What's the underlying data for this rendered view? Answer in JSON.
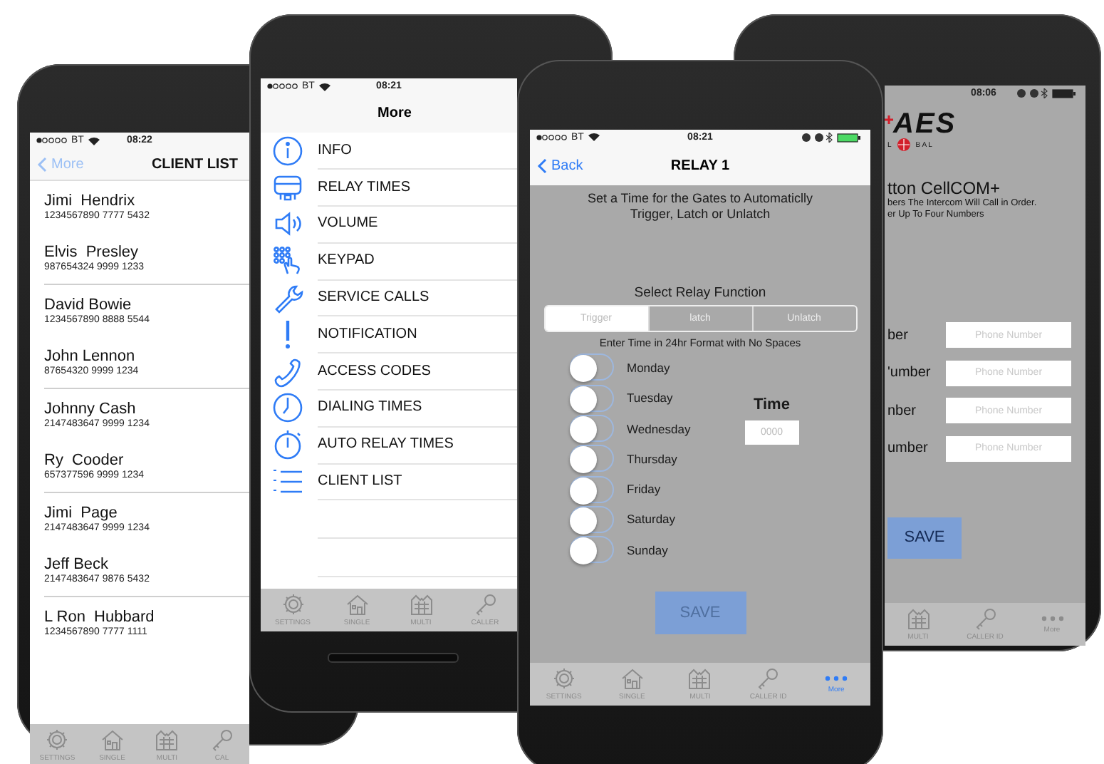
{
  "phones": [
    {
      "kind": "client_list",
      "status": {
        "carrier": "BT",
        "time": "08:22"
      },
      "nav": {
        "back": "More",
        "title": "CLIENT LIST"
      },
      "clients": [
        {
          "name": "Jimi  Hendrix",
          "number": "1234567890 7777 5432"
        },
        {
          "name": "Elvis  Presley",
          "number": "987654324 9999 1233"
        },
        {
          "name": "David Bowie",
          "number": "1234567890 8888 5544"
        },
        {
          "name": "John Lennon",
          "number": "87654320 9999 1234"
        },
        {
          "name": "Johnny Cash",
          "number": "2147483647 9999 1234"
        },
        {
          "name": "Ry  Cooder",
          "number": "657377596 9999 1234"
        },
        {
          "name": "Jimi  Page",
          "number": "2147483647 9999 1234"
        },
        {
          "name": "Jeff Beck",
          "number": "2147483647 9876 5432"
        },
        {
          "name": "L Ron  Hubbard",
          "number": "1234567890 7777 1111"
        }
      ],
      "tabs": [
        {
          "kind": "settings",
          "label": "SETTINGS",
          "selected": false
        },
        {
          "kind": "single",
          "label": "SINGLE",
          "selected": false
        },
        {
          "kind": "multi",
          "label": "MULTI",
          "selected": false
        },
        {
          "kind": "caller",
          "label": "CAL",
          "selected": false
        }
      ]
    },
    {
      "kind": "more_menu",
      "status": {
        "carrier": "BT",
        "time": "08:21"
      },
      "nav": {
        "title": "More"
      },
      "items": [
        {
          "kind": "info",
          "label": "INFO"
        },
        {
          "kind": "relay",
          "label": "RELAY TIMES"
        },
        {
          "kind": "volume",
          "label": "VOLUME"
        },
        {
          "kind": "keypad",
          "label": "KEYPAD"
        },
        {
          "kind": "wrench",
          "label": "SERVICE CALLS"
        },
        {
          "kind": "alert",
          "label": "NOTIFICATION"
        },
        {
          "kind": "phone",
          "label": "ACCESS CODES"
        },
        {
          "kind": "clock",
          "label": "DIALING TIMES"
        },
        {
          "kind": "stopwatch",
          "label": "AUTO RELAY TIMES"
        },
        {
          "kind": "list",
          "label": "CLIENT LIST"
        }
      ],
      "tabs": [
        {
          "kind": "settings",
          "label": "SETTINGS",
          "selected": false
        },
        {
          "kind": "single",
          "label": "SINGLE",
          "selected": false
        },
        {
          "kind": "multi",
          "label": "MULTI",
          "selected": false
        },
        {
          "kind": "caller",
          "label": "CALLER",
          "selected": false
        }
      ]
    },
    {
      "kind": "relay",
      "status": {
        "carrier": "BT",
        "time": "08:21"
      },
      "nav": {
        "back": "Back",
        "title": "RELAY 1"
      },
      "instructions": "Set a Time for the Gates to Automaticlly Trigger, Latch or Unlatch",
      "function_label": "Select Relay Function",
      "segments": [
        {
          "label": "Trigger",
          "selected": true
        },
        {
          "label": "latch",
          "selected": false
        },
        {
          "label": "Unlatch",
          "selected": false
        }
      ],
      "format_hint": "Enter Time in 24hr Format with No Spaces",
      "days": [
        {
          "label": "Monday",
          "on": false
        },
        {
          "label": "Tuesday",
          "on": false
        },
        {
          "label": "Wednesday",
          "on": false
        },
        {
          "label": "Thursday",
          "on": false
        },
        {
          "label": "Friday",
          "on": false
        },
        {
          "label": "Saturday",
          "on": false
        },
        {
          "label": "Sunday",
          "on": false
        }
      ],
      "time_label": "Time",
      "time_field": {
        "placeholder": "0000"
      },
      "save": "SAVE",
      "tabs": [
        {
          "kind": "settings",
          "label": "SETTINGS",
          "selected": false
        },
        {
          "kind": "single",
          "label": "SINGLE",
          "selected": false
        },
        {
          "kind": "multi",
          "label": "MULTI",
          "selected": false
        },
        {
          "kind": "caller",
          "label": "CALLER ID",
          "selected": false
        },
        {
          "kind": "more",
          "label": "More",
          "selected": true
        }
      ]
    },
    {
      "kind": "cellcom",
      "status": {
        "time": "08:06"
      },
      "logo": {
        "name": "AES",
        "sub_left": "L",
        "sub_right": "B A L"
      },
      "heading": "tton CellCOM+",
      "lines": [
        "bers The Intercom Will Call in Order.",
        "er Up To Four Numbers"
      ],
      "numbers": [
        {
          "label": "ber",
          "placeholder": "Phone Number"
        },
        {
          "label": "'umber",
          "placeholder": "Phone Number"
        },
        {
          "label": "nber",
          "placeholder": "Phone Number"
        },
        {
          "label": "umber",
          "placeholder": "Phone Number"
        }
      ],
      "save": "SAVE",
      "tabs": [
        {
          "kind": "multi",
          "label": "MULTI",
          "selected": false
        },
        {
          "kind": "caller",
          "label": "CALLER ID",
          "selected": false
        },
        {
          "kind": "more",
          "label": "More",
          "selected": false
        }
      ]
    }
  ]
}
